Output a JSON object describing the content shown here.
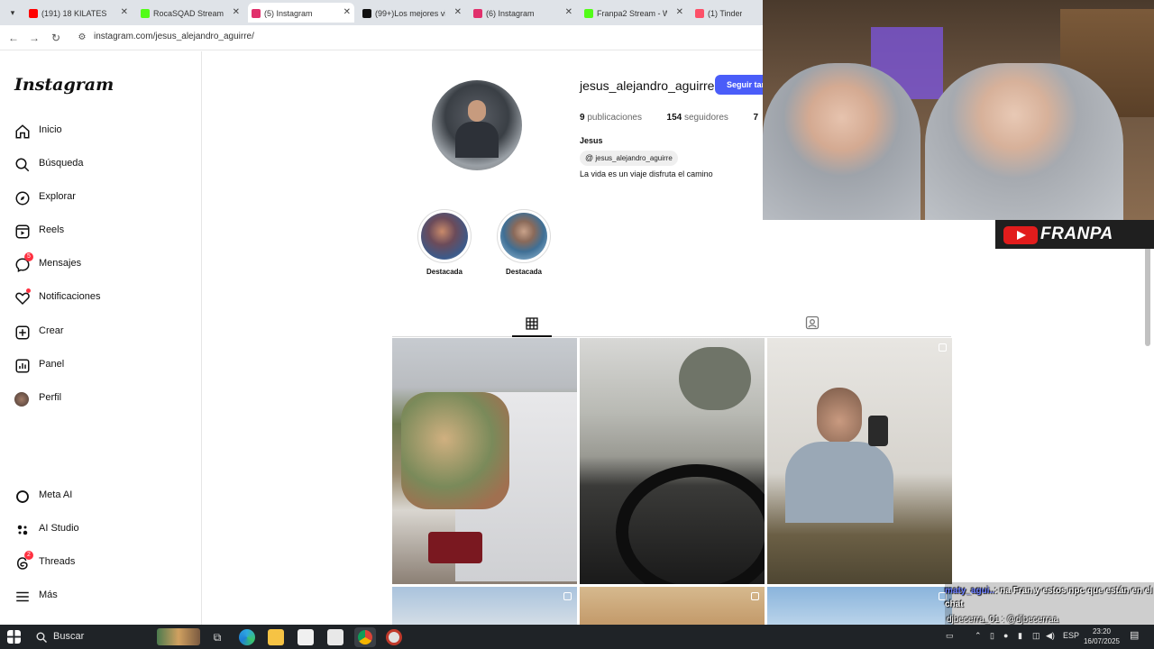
{
  "browser": {
    "tabs": [
      {
        "title": "(191) 18 KILATES",
        "fav_color": "#ff0000",
        "active": false
      },
      {
        "title": "RocaSQAD Stream",
        "fav_color": "#53fc18",
        "active": false
      },
      {
        "title": "(5) Instagram",
        "fav_color": "#e1306c",
        "active": true
      },
      {
        "title": "(99+)Los mejores vid",
        "fav_color": "#111111",
        "active": false
      },
      {
        "title": "(6) Instagram",
        "fav_color": "#e1306c",
        "active": false
      },
      {
        "title": "Franpa2 Stream - Wa",
        "fav_color": "#53fc18",
        "active": false
      },
      {
        "title": "(1) Tinder",
        "fav_color": "#fd5068",
        "active": false
      }
    ],
    "url": "instagram.com/jesus_alejandro_aguirre/"
  },
  "sidebar": {
    "logo": "Instagram",
    "items": [
      {
        "label": "Inicio",
        "icon": "home-icon"
      },
      {
        "label": "Búsqueda",
        "icon": "search-icon"
      },
      {
        "label": "Explorar",
        "icon": "compass-icon"
      },
      {
        "label": "Reels",
        "icon": "reels-icon"
      },
      {
        "label": "Mensajes",
        "icon": "messenger-icon",
        "badge": "5"
      },
      {
        "label": "Notificaciones",
        "icon": "heart-icon",
        "dot": true
      },
      {
        "label": "Crear",
        "icon": "plus-square-icon"
      },
      {
        "label": "Panel",
        "icon": "chart-icon"
      },
      {
        "label": "Perfil",
        "icon": "avatar"
      }
    ],
    "bottom_items": [
      {
        "label": "Meta AI",
        "icon": "meta-ai-icon"
      },
      {
        "label": "AI Studio",
        "icon": "ai-studio-icon"
      },
      {
        "label": "Threads",
        "icon": "threads-icon",
        "badge": "2"
      },
      {
        "label": "Más",
        "icon": "menu-icon"
      }
    ]
  },
  "profile": {
    "username": "jesus_alejandro_aguirre",
    "follow_label": "Seguir también",
    "posts_count": "9",
    "posts_label": "publicaciones",
    "followers_count": "154",
    "followers_label": "seguidores",
    "following_count": "7",
    "full_name": "Jesus",
    "threads_handle": "jesus_alejandro_aguirre",
    "bio": "La vida es un viaje disfruta el camino",
    "highlights": [
      {
        "label": "Destacada"
      },
      {
        "label": "Destacada"
      }
    ]
  },
  "overlay": {
    "brand": "FRANPA",
    "chat": {
      "user1": "maty_agui..",
      "msg1": ": na Fran y estos npc que están en el chat",
      "line2": "djbecerra_01 : @djbecerraa",
      "badge": "5"
    }
  },
  "taskbar": {
    "search_placeholder": "Buscar",
    "lang": "ESP",
    "time": "23:20",
    "date": "16/07/2025"
  }
}
